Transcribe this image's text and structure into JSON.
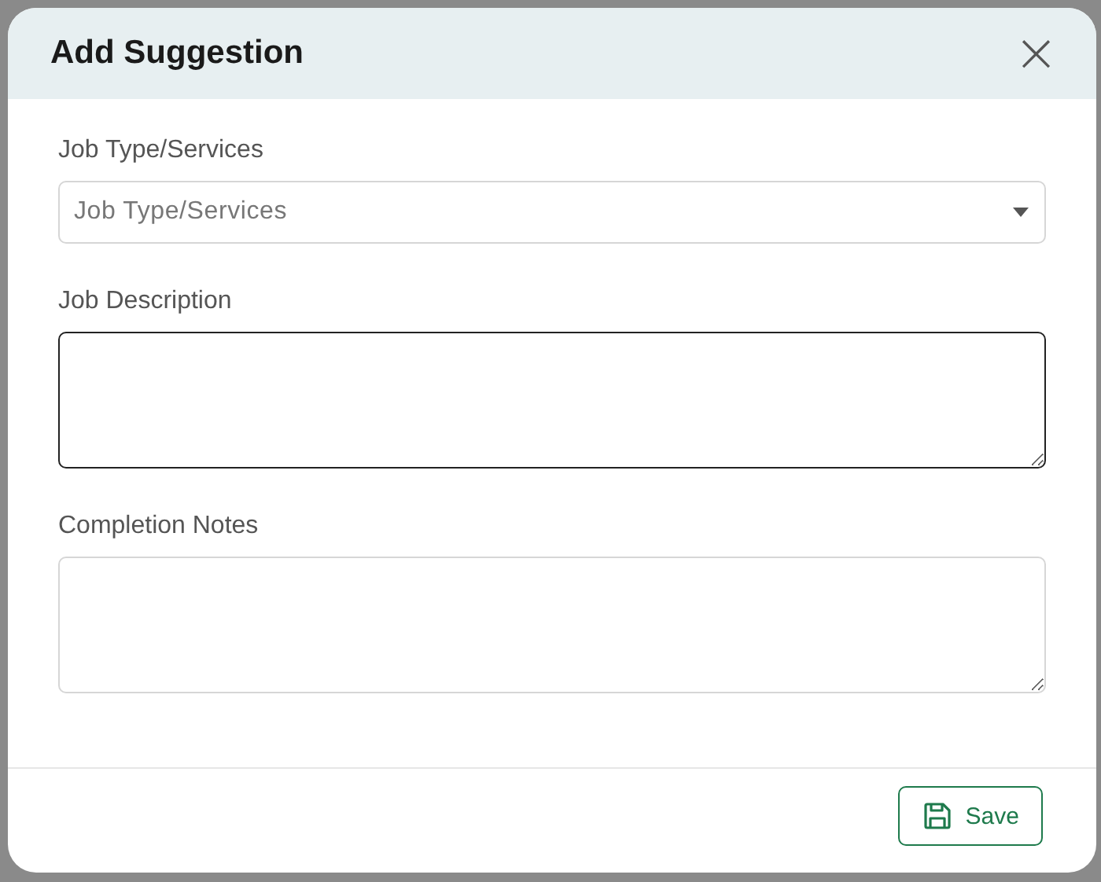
{
  "dialog": {
    "title": "Add Suggestion",
    "close": "×"
  },
  "fields": [
    {
      "kind": "select",
      "label": "Job Type/Services",
      "placeholder": "Job Type/Services",
      "focused": false
    },
    {
      "kind": "textarea",
      "label": "Job Description",
      "focused": true
    },
    {
      "kind": "textarea",
      "label": "Completion Notes",
      "focused": false
    }
  ],
  "buttons": [
    {
      "label": "Save"
    }
  ]
}
